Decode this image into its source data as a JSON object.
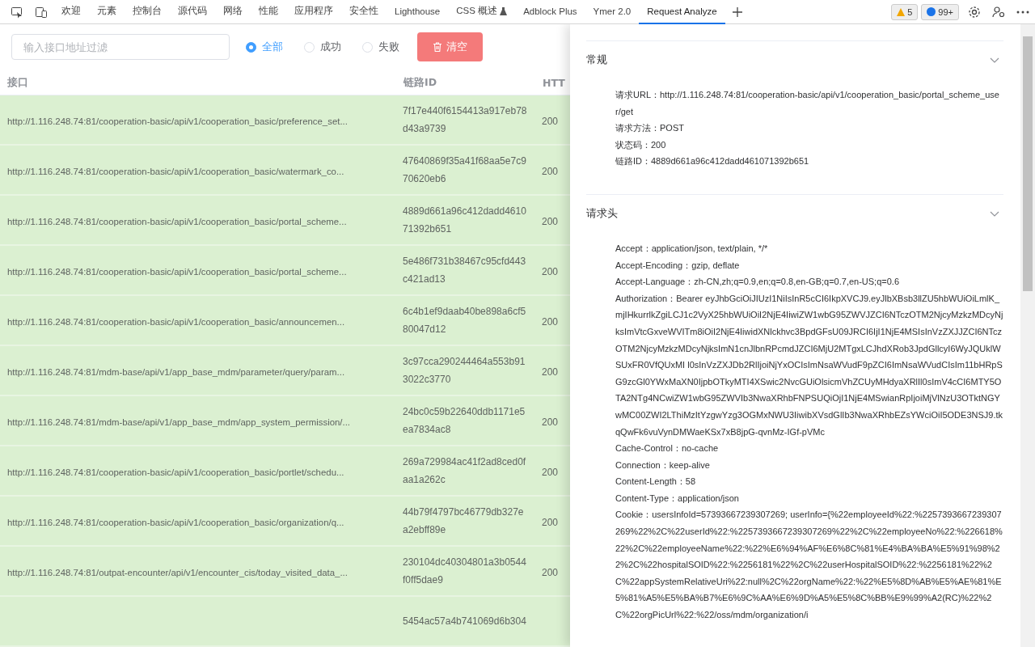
{
  "devtools_tabs": [
    {
      "label": "欢迎",
      "selected": false,
      "experimental": false
    },
    {
      "label": "元素",
      "selected": false,
      "experimental": false
    },
    {
      "label": "控制台",
      "selected": false,
      "experimental": false
    },
    {
      "label": "源代码",
      "selected": false,
      "experimental": false
    },
    {
      "label": "网络",
      "selected": false,
      "experimental": false
    },
    {
      "label": "性能",
      "selected": false,
      "experimental": false
    },
    {
      "label": "应用程序",
      "selected": false,
      "experimental": false
    },
    {
      "label": "安全性",
      "selected": false,
      "experimental": false
    },
    {
      "label": "Lighthouse",
      "selected": false,
      "experimental": false
    },
    {
      "label": "CSS 概述",
      "selected": false,
      "experimental": true
    },
    {
      "label": "Adblock Plus",
      "selected": false,
      "experimental": false
    },
    {
      "label": "Ymer 2.0",
      "selected": false,
      "experimental": false
    },
    {
      "label": "Request Analyze",
      "selected": true,
      "experimental": false
    }
  ],
  "issues": {
    "warnings": "5",
    "messages": "99+"
  },
  "filter": {
    "placeholder": "输入接口地址过滤"
  },
  "status_filter": [
    {
      "label": "全部",
      "selected": true
    },
    {
      "label": "成功",
      "selected": false
    },
    {
      "label": "失败",
      "selected": false
    }
  ],
  "clear_button": "清空",
  "table": {
    "columns": [
      "接口",
      "链路ID",
      "HTT"
    ],
    "rows": [
      {
        "url": "http://1.116.248.74:81/cooperation-basic/api/v1/cooperation_basic/preference_set...",
        "trace_id": "7f17e440f6154413a917eb78d43a9739",
        "status": "200"
      },
      {
        "url": "http://1.116.248.74:81/cooperation-basic/api/v1/cooperation_basic/watermark_co...",
        "trace_id": "47640869f35a41f68aa5e7c970620eb6",
        "status": "200"
      },
      {
        "url": "http://1.116.248.74:81/cooperation-basic/api/v1/cooperation_basic/portal_scheme...",
        "trace_id": "4889d661a96c412dadd461071392b651",
        "status": "200"
      },
      {
        "url": "http://1.116.248.74:81/cooperation-basic/api/v1/cooperation_basic/portal_scheme...",
        "trace_id": "5e486f731b38467c95cfd443c421ad13",
        "status": "200"
      },
      {
        "url": "http://1.116.248.74:81/cooperation-basic/api/v1/cooperation_basic/announcemen...",
        "trace_id": "6c4b1ef9daab40be898a6cf580047d12",
        "status": "200"
      },
      {
        "url": "http://1.116.248.74:81/mdm-base/api/v1/app_base_mdm/parameter/query/param...",
        "trace_id": "3c97cca290244464a553b913022c3770",
        "status": "200"
      },
      {
        "url": "http://1.116.248.74:81/mdm-base/api/v1/app_base_mdm/app_system_permission/...",
        "trace_id": "24bc0c59b22640ddb1171e5ea7834ac8",
        "status": "200"
      },
      {
        "url": "http://1.116.248.74:81/cooperation-basic/api/v1/cooperation_basic/portlet/schedu...",
        "trace_id": "269a729984ac41f2ad8ced0faa1a262c",
        "status": "200"
      },
      {
        "url": "http://1.116.248.74:81/cooperation-basic/api/v1/cooperation_basic/organization/q...",
        "trace_id": "44b79f4797bc46779db327ea2ebff89e",
        "status": "200"
      },
      {
        "url": "http://1.116.248.74:81/outpat-encounter/api/v1/encounter_cis/today_visited_data_...",
        "trace_id": "230104dc40304801a3b0544f0ff5dae9",
        "status": "200"
      },
      {
        "trace_id": "5454ac57a4b741069d6b304"
      }
    ]
  },
  "drawer": {
    "sections": [
      {
        "title": "常规",
        "expanded": true,
        "lines": [
          "请求URL：http://1.116.248.74:81/cooperation-basic/api/v1/cooperation_basic/portal_scheme_user/get",
          "请求方法：POST",
          "状态码：200",
          "链路ID：4889d661a96c412dadd461071392b651"
        ]
      },
      {
        "title": "请求头",
        "expanded": true,
        "lines": [
          "Accept：application/json, text/plain, */*",
          "Accept-Encoding：gzip, deflate",
          "Accept-Language：zh-CN,zh;q=0.9,en;q=0.8,en-GB;q=0.7,en-US;q=0.6",
          "Authorization：Bearer eyJhbGciOiJIUzI1NiIsInR5cCI6IkpXVCJ9.eyJlbXBsb3llZU5hbWUiOiLmlK_mjIHkurrlkZgiLCJ1c2VyX25hbWUiOiI2NjE4IiwiZW1wbG95ZWVJZCI6NTczOTM2NjcyMzkzMDcyNjksImVtcGxveWVITm8iOiI2NjE4IiwidXNlckhvc3BpdGFsU09JRCI6IjI1NjE4MSIsInVzZXJJZCI6NTczOTM2NjcyMzkzMDcyNjksImN1cnJlbnRPcmdJZCI6MjU2MTgxLCJhdXRob3JpdGllcyI6WyJQUklWSUxFR0VfQUxMI l0sInVzZXJDb2RlIjoiNjYxOCIsImNsaWVudF9pZCI6ImNsaWVudCIsIm11bHRpSG9zcGl0YWxMaXN0IjpbOTkyMTI4XSwic2NvcGUiOlsicmVhZCUyMHdyaXRlIl0sImV4cCI6MTY5OTA2NTg4NCwiZW1wbG95ZWVIb3NwaXRhbFNPSUQiOjI1NjE4MSwianRpIjoiMjVlNzU3OTktNGYwMC00ZWI2LThiMzItYzgwYzg3OGMxNWU3IiwibXVsdGlIb3NwaXRhbEZsYWciOiI5ODE3NSJ9.tkqQwFk6vuVynDMWaeKSx7xB8jpG-qvnMz-IGf-pVMc",
          "Cache-Control：no-cache",
          "Connection：keep-alive",
          "Content-Length：58",
          "Content-Type：application/json",
          "Cookie：usersInfoId=57393667239307269; userInfo={%22employeeId%22:%2257393667239307269%22%2C%22userId%22:%2257393667239307269%22%2C%22employeeNo%22:%226618%22%2C%22employeeName%22:%22%E6%94%AF%E6%8C%81%E4%BA%BA%E5%91%98%22%2C%22hospitalSOID%22:%2256181%22%2C%22userHospitalSOID%22:%2256181%22%2C%22appSystemRelativeUri%22:null%2C%22orgName%22:%22%E5%8D%AB%E5%AE%81%E5%81%A5%E5%BA%B7%E6%9C%AA%E6%9D%A5%E5%8C%BB%E9%99%A2(RC)%22%2C%22orgPicUrl%22:%22/oss/mdm/organization/i"
        ]
      }
    ]
  }
}
